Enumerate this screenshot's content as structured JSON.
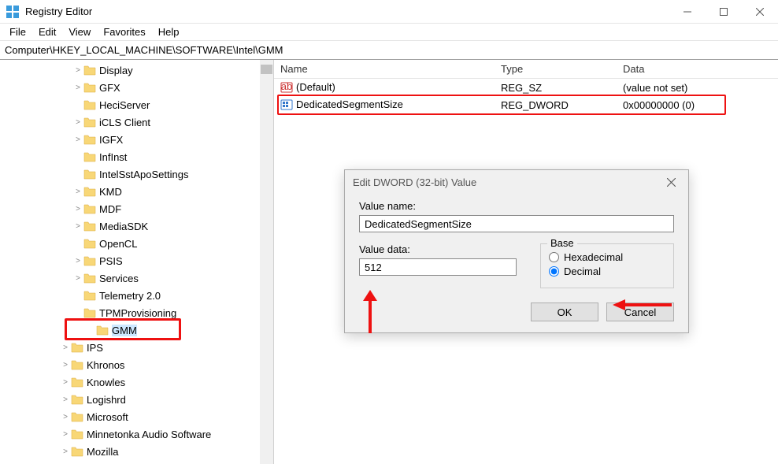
{
  "titlebar": {
    "title": "Registry Editor"
  },
  "menubar": {
    "items": [
      "File",
      "Edit",
      "View",
      "Favorites",
      "Help"
    ]
  },
  "addressbar": {
    "path": "Computer\\HKEY_LOCAL_MACHINE\\SOFTWARE\\Intel\\GMM"
  },
  "tree": {
    "items": [
      {
        "label": "Display",
        "indent": 92,
        "expander": ">"
      },
      {
        "label": "GFX",
        "indent": 92,
        "expander": ">"
      },
      {
        "label": "HeciServer",
        "indent": 92,
        "expander": ""
      },
      {
        "label": "iCLS Client",
        "indent": 92,
        "expander": ">"
      },
      {
        "label": "IGFX",
        "indent": 92,
        "expander": ">"
      },
      {
        "label": "InfInst",
        "indent": 92,
        "expander": ""
      },
      {
        "label": "IntelSstApoSettings",
        "indent": 92,
        "expander": ""
      },
      {
        "label": "KMD",
        "indent": 92,
        "expander": ">"
      },
      {
        "label": "MDF",
        "indent": 92,
        "expander": ">"
      },
      {
        "label": "MediaSDK",
        "indent": 92,
        "expander": ">"
      },
      {
        "label": "OpenCL",
        "indent": 92,
        "expander": ""
      },
      {
        "label": "PSIS",
        "indent": 92,
        "expander": ">"
      },
      {
        "label": "Services",
        "indent": 92,
        "expander": ">"
      },
      {
        "label": "Telemetry 2.0",
        "indent": 92,
        "expander": ""
      },
      {
        "label": "TPMProvisioning",
        "indent": 92,
        "expander": ""
      },
      {
        "label": "GMM",
        "indent": 108,
        "expander": "",
        "selected": true,
        "highlighted": true
      },
      {
        "label": "IPS",
        "indent": 76,
        "expander": ">"
      },
      {
        "label": "Khronos",
        "indent": 76,
        "expander": ">"
      },
      {
        "label": "Knowles",
        "indent": 76,
        "expander": ">"
      },
      {
        "label": "Logishrd",
        "indent": 76,
        "expander": ">"
      },
      {
        "label": "Microsoft",
        "indent": 76,
        "expander": ">"
      },
      {
        "label": "Minnetonka Audio Software",
        "indent": 76,
        "expander": ">"
      },
      {
        "label": "Mozilla",
        "indent": 76,
        "expander": ">"
      }
    ]
  },
  "list": {
    "headers": {
      "name": "Name",
      "type": "Type",
      "data": "Data"
    },
    "rows": [
      {
        "name": "(Default)",
        "type": "REG_SZ",
        "data": "(value not set)",
        "icon": "string"
      },
      {
        "name": "DedicatedSegmentSize",
        "type": "REG_DWORD",
        "data": "0x00000000 (0)",
        "icon": "binary",
        "highlighted": true
      }
    ]
  },
  "dialog": {
    "title": "Edit DWORD (32-bit) Value",
    "value_name_label": "Value name:",
    "value_name": "DedicatedSegmentSize",
    "value_data_label": "Value data:",
    "value_data": "512",
    "base_label": "Base",
    "hex_label": "Hexadecimal",
    "dec_label": "Decimal",
    "base_selected": "decimal",
    "ok_label": "OK",
    "cancel_label": "Cancel"
  }
}
